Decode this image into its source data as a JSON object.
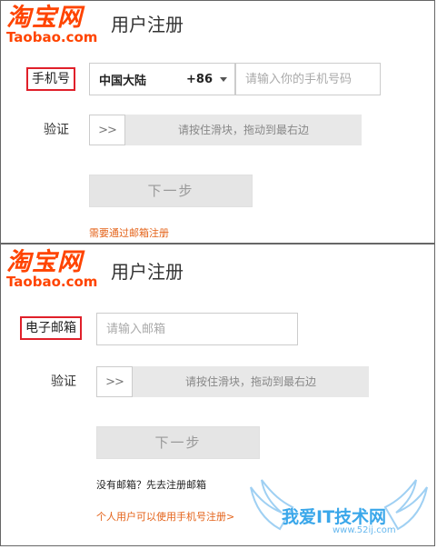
{
  "panel1": {
    "logo_cn": "淘宝网",
    "logo_en": "Taobao.com",
    "title": "用户注册",
    "phone_label": "手机号",
    "country": "中国大陆",
    "country_code": "+86",
    "phone_placeholder": "请输入你的手机号码",
    "verify_label": "验证",
    "slider_handle": ">>",
    "slider_text": "请按住滑块，拖动到最右边",
    "next_button": "下一步",
    "email_link": "需要通过邮箱注册"
  },
  "panel2": {
    "logo_cn": "淘宝网",
    "logo_en": "Taobao.com",
    "title": "用户注册",
    "email_label": "电子邮箱",
    "email_placeholder": "请输入邮箱",
    "verify_label": "验证",
    "slider_handle": ">>",
    "slider_text": "请按住滑块，拖动到最右边",
    "next_button": "下一步",
    "no_email_text": "没有邮箱？先去注册邮箱",
    "phone_link": "个人用户可以使用手机号注册>"
  },
  "watermark": {
    "text": "我爱IT技术网",
    "url": "www.52ij.com"
  },
  "colors": {
    "brand": "#ff4400",
    "highlight_border": "#e0202a",
    "link": "#e4631a",
    "watermark": "#3aa7ea"
  }
}
